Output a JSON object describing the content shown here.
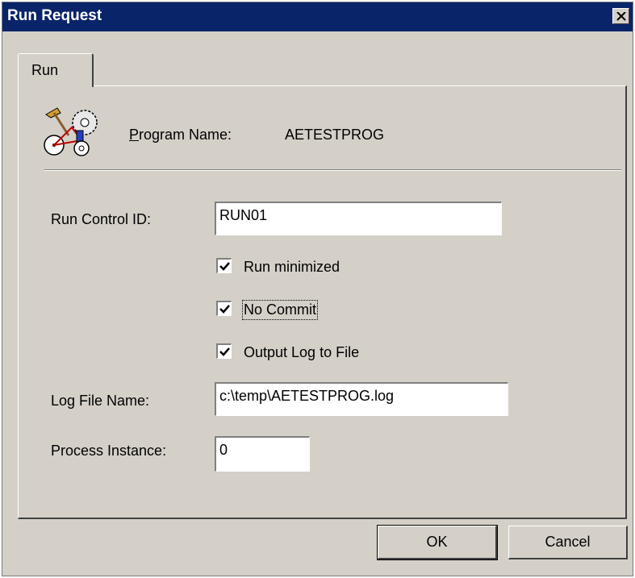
{
  "window": {
    "title": "Run Request"
  },
  "tabs": [
    {
      "label": "Run"
    }
  ],
  "program": {
    "label_mnemonic": "P",
    "label_rest": "rogram Name:",
    "value": "AETESTPROG"
  },
  "run_control": {
    "label": "Run Control ID:",
    "value": "RUN01"
  },
  "options": [
    {
      "label": "Run minimized",
      "checked": true
    },
    {
      "label": "No Commit",
      "checked": true
    },
    {
      "label": "Output Log to File",
      "checked": true
    }
  ],
  "log_file": {
    "label": "Log File Name:",
    "value": "c:\\temp\\AETESTPROG.log"
  },
  "process_instance": {
    "label": "Process Instance:",
    "value": "0"
  },
  "buttons": {
    "ok": "OK",
    "cancel": "Cancel"
  },
  "icons": {
    "close": "close-icon",
    "program": "process-program-icon",
    "checkbox": "checkmark-icon"
  },
  "colors": {
    "titlebar": "#0a246a",
    "face": "#d4d0c8"
  }
}
